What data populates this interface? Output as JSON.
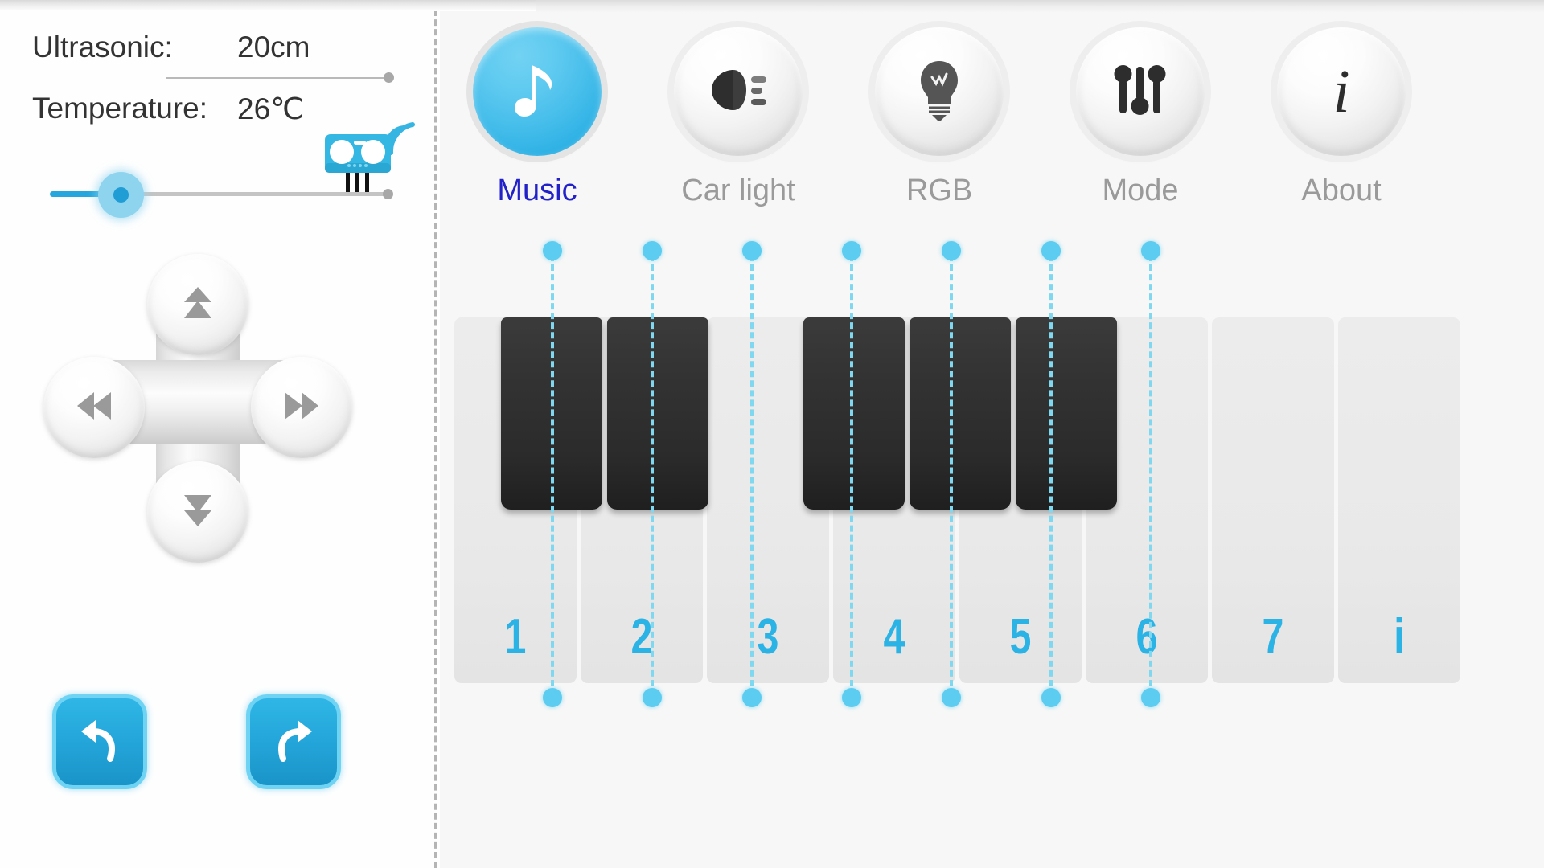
{
  "left_panel": {
    "sensors": [
      {
        "label": "Ultrasonic:",
        "value": "20cm",
        "icon": "divider-line-with-dot"
      },
      {
        "label": "Temperature:",
        "value": "26℃",
        "icon": "ultrasonic-sensor-icon"
      }
    ],
    "speed_slider": {
      "name": "speed-slider",
      "value_percent": 21,
      "fill_color": "#25a7dd",
      "thumb_color": "#8ed4ee",
      "track_color": "#c4c4c4"
    },
    "dpad": {
      "name": "direction-pad",
      "buttons": [
        {
          "name": "dpad-up-button",
          "icon": "double-chevron-up-icon"
        },
        {
          "name": "dpad-left-button",
          "icon": "double-chevron-left-icon"
        },
        {
          "name": "dpad-right-button",
          "icon": "double-chevron-right-icon"
        },
        {
          "name": "dpad-down-button",
          "icon": "double-chevron-down-icon"
        }
      ]
    },
    "turn_buttons": [
      {
        "name": "turn-left-button",
        "icon": "curved-arrow-left-icon",
        "color": "#24a6da"
      },
      {
        "name": "turn-right-button",
        "icon": "curved-arrow-right-icon",
        "color": "#24a6da"
      }
    ]
  },
  "right_panel": {
    "nav": {
      "active_color": "#2222c8",
      "inactive_color": "#9a9a9a",
      "active_circle_color": "#43bcea",
      "items": [
        {
          "label": "Music",
          "icon": "music-note-icon",
          "active": true
        },
        {
          "label": "Car light",
          "icon": "headlight-icon",
          "active": false
        },
        {
          "label": "RGB",
          "icon": "light-bulb-icon",
          "active": false
        },
        {
          "label": "Mode",
          "icon": "sliders-icon",
          "active": false
        },
        {
          "label": "About",
          "icon": "info-italic-i-icon",
          "active": false
        }
      ]
    },
    "piano": {
      "number_color": "#2cb3e5",
      "guide_color": "#7fd8ef",
      "white_keys": [
        {
          "label": "1"
        },
        {
          "label": "2"
        },
        {
          "label": "3"
        },
        {
          "label": "4"
        },
        {
          "label": "5"
        },
        {
          "label": "6"
        },
        {
          "label": "7"
        },
        {
          "label": "i"
        }
      ],
      "black_keys_count": 5
    }
  }
}
